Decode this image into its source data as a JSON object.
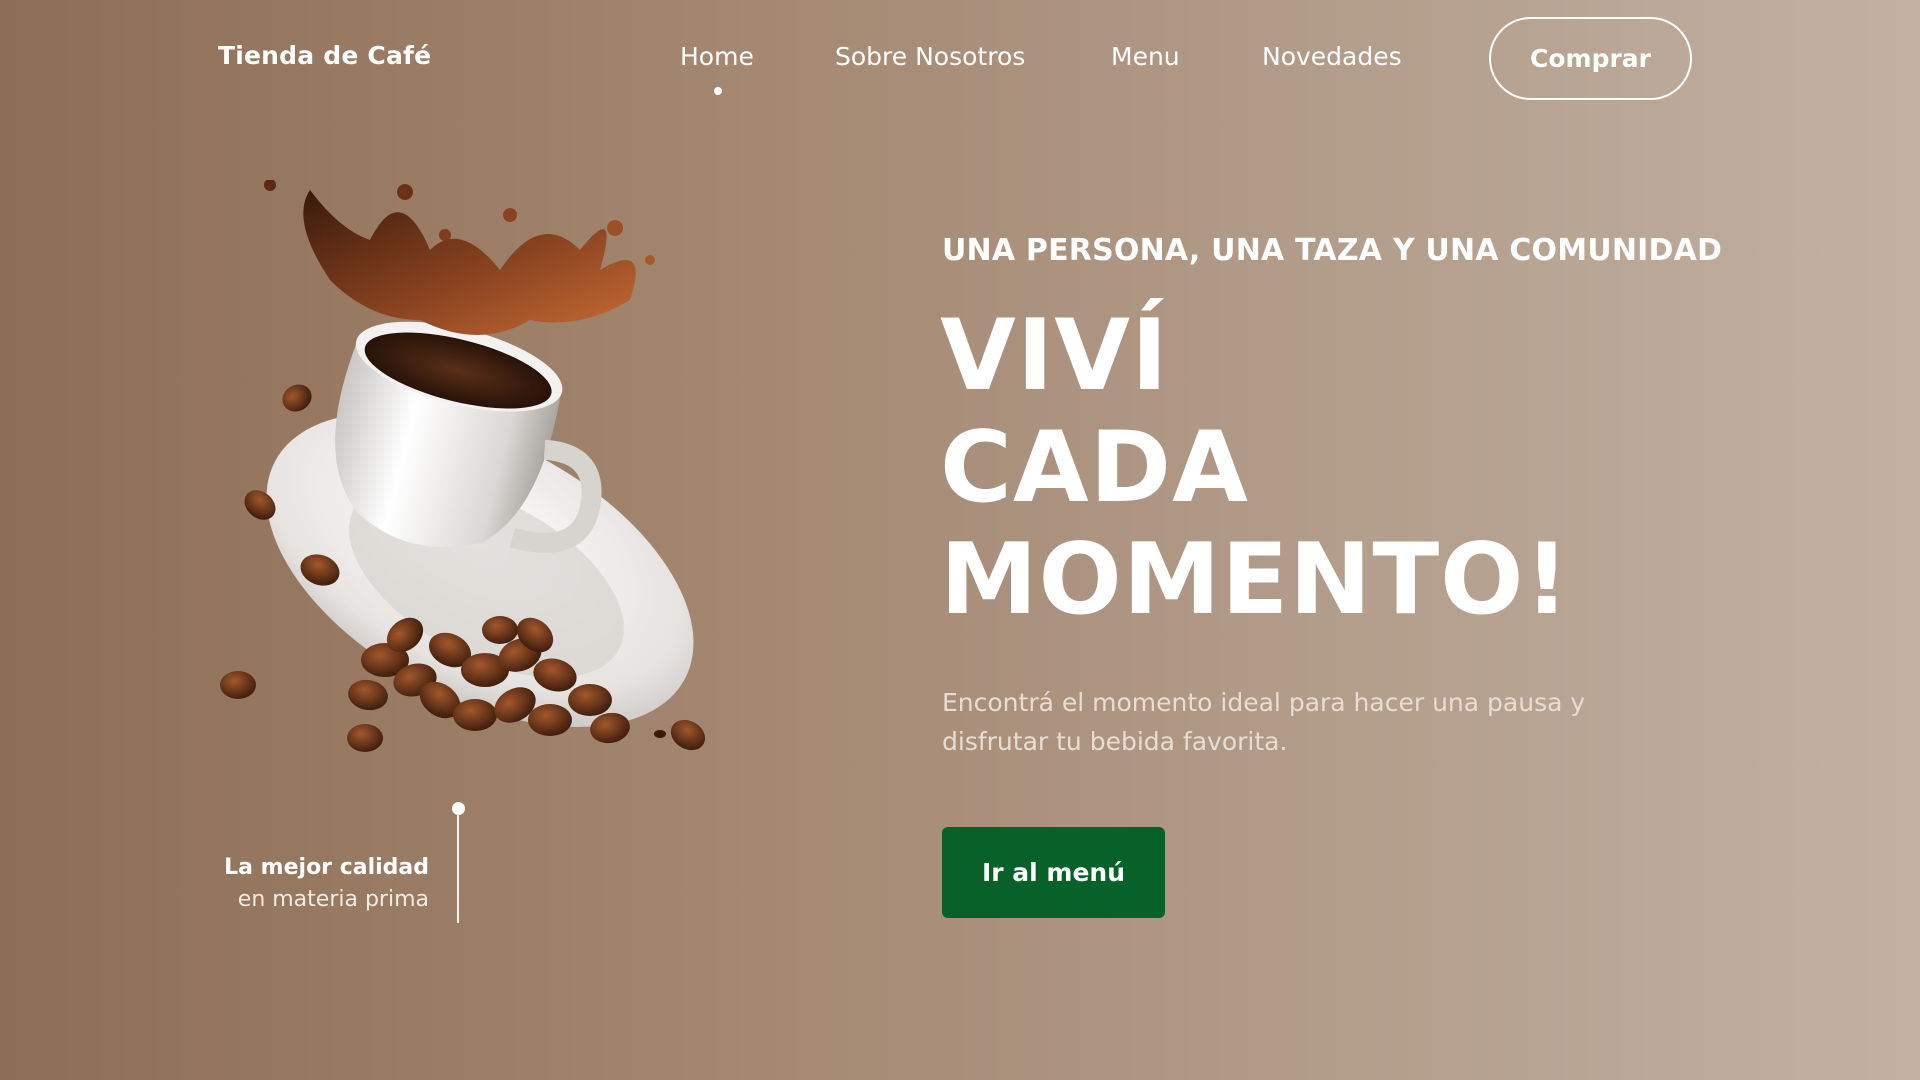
{
  "nav": {
    "brand": "Tienda de Café",
    "items": [
      {
        "label": "Home",
        "active": true
      },
      {
        "label": "Sobre Nosotros",
        "active": false
      },
      {
        "label": "Menu",
        "active": false
      },
      {
        "label": "Novedades",
        "active": false
      }
    ],
    "buy_label": "Comprar"
  },
  "hero": {
    "eyebrow": "UNA PERSONA, UNA TAZA Y UNA COMUNIDAD",
    "headline": [
      "VIVÍ",
      "CADA",
      "MOMENTO!"
    ],
    "description": "Encontrá el momento ideal para hacer una pausa y disfrutar tu bebida favorita.",
    "cta_label": "Ir al menú",
    "quality_title": "La mejor calidad",
    "quality_sub": "en materia prima"
  },
  "colors": {
    "accent": "#066228",
    "background_start": "#8d6d55",
    "background_end": "#c2b1a2",
    "text": "#ffffff"
  },
  "icons": [
    "coffee-cup-illustration",
    "coffee-bean-icon"
  ]
}
